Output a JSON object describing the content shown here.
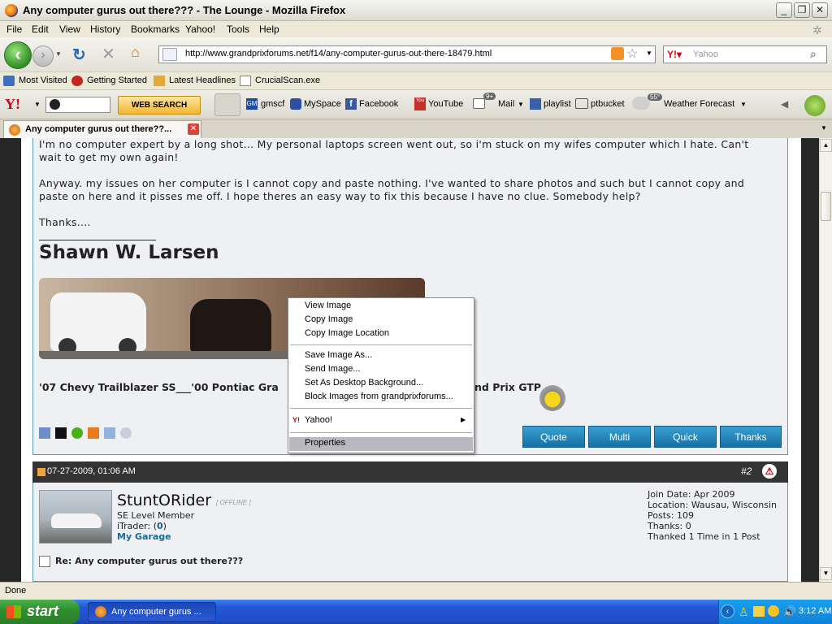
{
  "window": {
    "title": "Any computer gurus out there??? - The Lounge - Mozilla Firefox"
  },
  "menubar": [
    "File",
    "Edit",
    "View",
    "History",
    "Bookmarks",
    "Yahoo!",
    "Tools",
    "Help"
  ],
  "navbar": {
    "url": "http://www.grandprixforums.net/f14/any-computer-gurus-out-there-18479.html",
    "search_placeholder": "Yahoo"
  },
  "bookmarks": [
    "Most Visited",
    "Getting Started",
    "Latest Headlines",
    "CrucialScan.exe"
  ],
  "yahoo_toolbar": {
    "search_button": "WEB SEARCH",
    "items": [
      "gmscf",
      "MySpace",
      "Facebook",
      "YouTube",
      "Mail",
      "playlist",
      "ptbucket",
      "Weather Forecast"
    ],
    "mail_badge": "9+",
    "weather_badge": "55°"
  },
  "tab": {
    "label": "Any computer gurus out there??..."
  },
  "post1": {
    "line1": "I'm no computer expert by a long shot... My personal laptops screen went out, so i'm stuck on my wifes computer which I hate. Can't",
    "line2": "wait to get my own again!",
    "line3": "Anyway. my issues on her computer is I cannot copy and paste nothing. I've wanted to share photos and such but I cannot copy and",
    "line4": "paste on here and it pisses me off. I hope theres an easy way to fix this because I have no clue. Somebody help?",
    "line5": "Thanks....",
    "signature_name": "Shawn W. Larsen",
    "cars_line": "'07 Chevy Trailblazer SS___'00 Pontiac Gra",
    "cars_line_end": "nd Prix GTP",
    "buttons": [
      "Quote",
      "Multi",
      "Quick",
      "Thanks"
    ]
  },
  "post2": {
    "date": "07-27-2009, 01:06 AM",
    "number": "#2",
    "username": "StuntORider",
    "status": "[ OFFLINE ]",
    "rank": "SE Level Member",
    "itrader_label": "iTrader: (",
    "itrader_value": "0",
    "itrader_close": ")",
    "garage": "My Garage",
    "join_date": "Join Date: Apr 2009",
    "location": "Location: Wausau, Wisconsin",
    "posts": "Posts: 109",
    "thanks": "Thanks: 0",
    "thanked": "Thanked 1 Time in 1 Post",
    "subject": "Re: Any computer gurus out there???"
  },
  "context_menu": {
    "items": [
      "View Image",
      "Copy Image",
      "Copy Image Location",
      "Save Image As...",
      "Send Image...",
      "Set As Desktop Background...",
      "Block Images from grandprixforums...",
      "Yahoo!",
      "Properties"
    ],
    "selected": "Properties"
  },
  "status": "Done",
  "taskbar": {
    "start": "start",
    "item": "Any computer gurus ...",
    "clock": "3:12 AM"
  },
  "colors": {
    "taskbar_blue": "#2457d6",
    "start_green": "#2f8f2e",
    "button_blue": "#1670a8",
    "post_border": "#5a98b8"
  }
}
